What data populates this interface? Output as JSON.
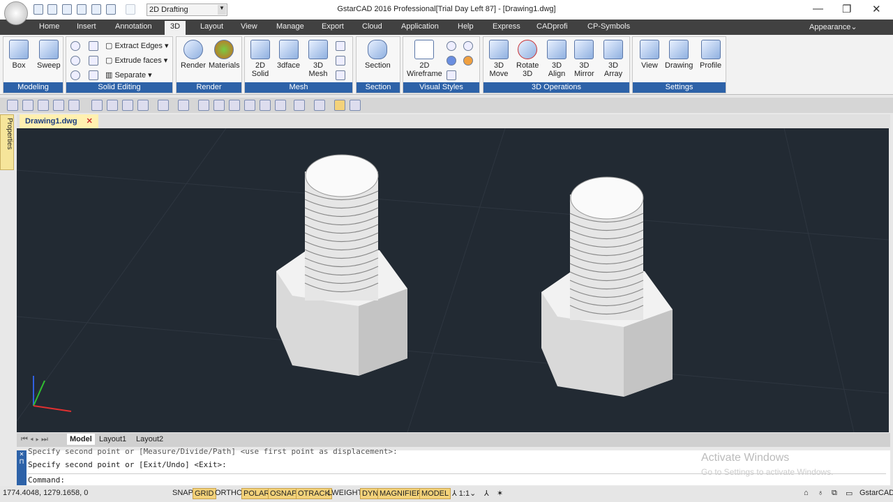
{
  "app": {
    "title": "GstarCAD 2016 Professional[Trial Day Left 87] - [Drawing1.dwg]",
    "workspace": "2D Drafting"
  },
  "menu": [
    "Home",
    "Insert",
    "Annotation",
    "3D",
    "Layout",
    "View",
    "Manage",
    "Export",
    "Cloud",
    "Application",
    "Help",
    "Express",
    "CADprofi",
    "CP-Symbols"
  ],
  "appearance": "Appearance",
  "ribbon": {
    "modeling": {
      "label": "Modeling",
      "box": "Box",
      "sweep": "Sweep"
    },
    "solid_editing": {
      "label": "Solid Editing",
      "extract": "Extract Edges",
      "extrude": "Extrude faces",
      "separate": "Separate"
    },
    "render": {
      "label": "Render",
      "render": "Render",
      "materials": "Materials"
    },
    "mesh": {
      "label": "Mesh",
      "solid2d": [
        "2D",
        "Solid"
      ],
      "face3d": "3dface",
      "mesh3d": [
        "3D",
        "Mesh"
      ]
    },
    "section": {
      "label": "Section",
      "section": "Section"
    },
    "visual": {
      "label": "Visual Styles",
      "wire": [
        "2D",
        "Wireframe"
      ]
    },
    "ops": {
      "label": "3D Operations",
      "move": [
        "3D",
        "Move"
      ],
      "rotate": [
        "Rotate",
        "3D"
      ],
      "align": [
        "3D",
        "Align"
      ],
      "mirror": [
        "3D",
        "Mirror"
      ],
      "array": [
        "3D",
        "Array"
      ]
    },
    "settings": {
      "label": "Settings",
      "view": "View",
      "drawing": "Drawing",
      "profile": "Profile"
    }
  },
  "doc_tab": "Drawing1.dwg",
  "properties": "Properties",
  "layout_tabs": [
    "Model",
    "Layout1",
    "Layout2"
  ],
  "command": {
    "line1": "Specify second point or [Measure/Divide/Path] <use first point as displacement>:",
    "line2": "Specify second point or [Exit/Undo] <Exit>:",
    "prompt": "Command:"
  },
  "status": {
    "coords": "1774.4048, 1279.1658, 0",
    "toggles": [
      {
        "label": "SNAP",
        "on": false
      },
      {
        "label": "GRID",
        "on": true
      },
      {
        "label": "ORTHO",
        "on": false
      },
      {
        "label": "POLAR",
        "on": true
      },
      {
        "label": "OSNAP",
        "on": true
      },
      {
        "label": "OTRACK",
        "on": true
      },
      {
        "label": "LWEIGHT",
        "on": false
      },
      {
        "label": "DYN",
        "on": true
      },
      {
        "label": "MAGNIFIER",
        "on": true
      },
      {
        "label": "MODEL",
        "on": true
      }
    ],
    "scale": "1:1",
    "app": "GstarCAD"
  },
  "watermark": {
    "title": "Activate Windows",
    "sub": "Go to Settings to activate Windows."
  }
}
